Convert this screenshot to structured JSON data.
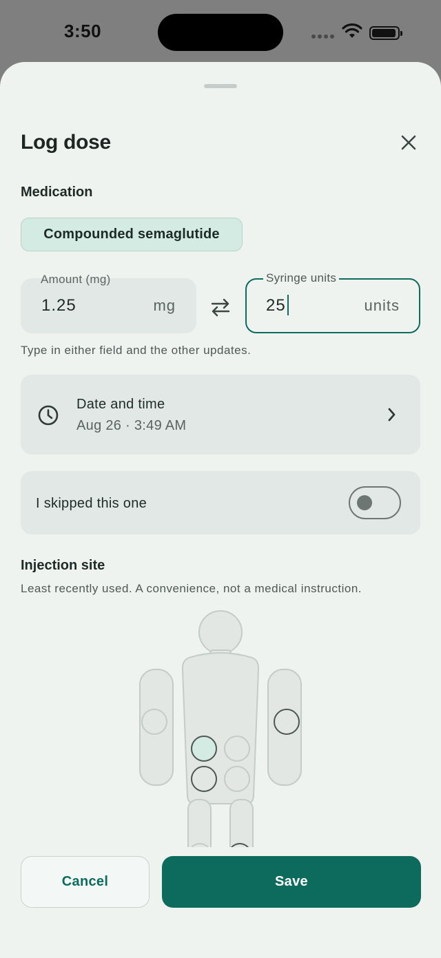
{
  "status_bar": {
    "time": "3:50",
    "icons": [
      "signal-dots-icon",
      "wifi-icon",
      "battery-icon"
    ]
  },
  "sheet": {
    "title": "Log dose",
    "close_icon": "close-icon"
  },
  "medication": {
    "label": "Medication",
    "selected": "Compounded semaglutide"
  },
  "dose": {
    "amount": {
      "label": "Amount (mg)",
      "value": "1.25",
      "unit": "mg"
    },
    "syringe": {
      "label": "Syringe units",
      "value": "25",
      "unit": "units"
    },
    "swap_icon": "swap-arrows-icon",
    "hint": "Type in either field and the other updates."
  },
  "datetime": {
    "title": "Date and time",
    "value": "Aug 26 · 3:49 AM",
    "icon": "clock-icon"
  },
  "skip": {
    "label": "I skipped this one",
    "toggle_on": false
  },
  "injection_site": {
    "label": "Injection site",
    "subtitle": "Least recently used. A convenience, not a medical instruction.",
    "suggested_site": "abdomen-upper-left"
  },
  "footer": {
    "cancel_label": "Cancel",
    "save_label": "Save"
  },
  "colors": {
    "accent": "#0c6b5d",
    "sheet_bg": "#eef3f0",
    "card_bg": "#e2e8e5",
    "chip_bg": "#d4ebe3"
  }
}
